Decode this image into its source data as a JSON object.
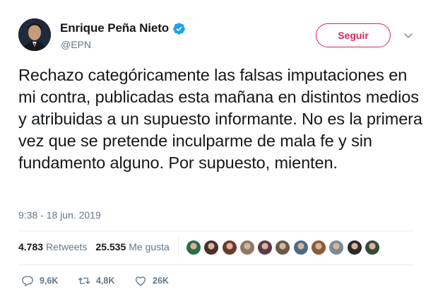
{
  "user": {
    "display_name": "Enrique Peña Nieto",
    "handle": "@EPN",
    "verified": true
  },
  "follow_button": {
    "label": "Seguir"
  },
  "tweet": {
    "text": "Rechazo categóricamente las falsas imputaciones en mi contra, publicadas esta mañana en distintos medios y atribuidas a un supuesto informante. No es la primera vez que se pretende inculparme de mala fe y sin fundamento alguno. Por supuesto, mienten.",
    "timestamp": "9:38 - 18 jun. 2019"
  },
  "stats": {
    "retweets_count": "4.783",
    "retweets_label": "Retweets",
    "likes_count": "25.535",
    "likes_label": "Me gusta"
  },
  "likers": [
    {
      "color": "#2e6b4a"
    },
    {
      "color": "#4a2e2e"
    },
    {
      "color": "#6b3a2a"
    },
    {
      "color": "#8a7a6a"
    },
    {
      "color": "#5a3a4a"
    },
    {
      "color": "#6a5a4a"
    },
    {
      "color": "#4a6a8a"
    },
    {
      "color": "#8a5a3a"
    },
    {
      "color": "#7a8a9a"
    },
    {
      "color": "#2a2a2a"
    },
    {
      "color": "#3a4a3a"
    }
  ],
  "actions": {
    "replies": "9,6K",
    "retweets": "4,8K",
    "likes": "26K"
  },
  "colors": {
    "accent": "#e0245e",
    "verified": "#1da1f2",
    "muted": "#657786"
  }
}
